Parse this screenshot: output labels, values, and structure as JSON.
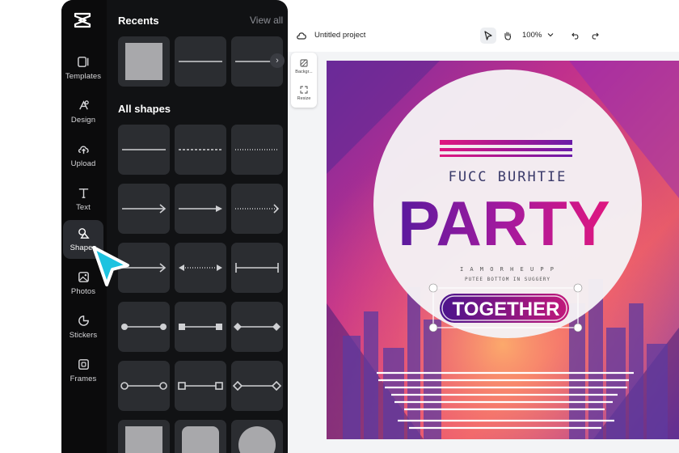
{
  "sidebar": {
    "items": [
      {
        "label": "Templates",
        "icon": "templates-icon"
      },
      {
        "label": "Design",
        "icon": "design-icon"
      },
      {
        "label": "Upload",
        "icon": "upload-cloud-icon"
      },
      {
        "label": "Text",
        "icon": "text-icon"
      },
      {
        "label": "Shapes",
        "icon": "shapes-icon",
        "active": true
      },
      {
        "label": "Photos",
        "icon": "photos-icon"
      },
      {
        "label": "Stickers",
        "icon": "stickers-icon"
      },
      {
        "label": "Frames",
        "icon": "frames-icon"
      }
    ]
  },
  "panel": {
    "recents_title": "Recents",
    "view_all": "View all",
    "all_shapes_title": "All shapes"
  },
  "toolbar": {
    "project_title": "Untitled project",
    "zoom": "100%"
  },
  "float_panel": {
    "background_label": "Backgr...",
    "resize_label": "Resize"
  },
  "poster": {
    "subtitle": "FUCC BURHTIE",
    "title": "PARTY",
    "tagline": "TOGETHER",
    "small_line_1": "I A M O R H  E  U P P",
    "small_line_2": "PUTEE BOTTOM IN SUGGERY"
  },
  "colors": {
    "accent_cyan": "#1ec3e0",
    "party_purple": "#6a1aa8",
    "party_pink": "#e0177f",
    "panel_bg": "#111214",
    "tile_bg": "#2b2d31"
  }
}
